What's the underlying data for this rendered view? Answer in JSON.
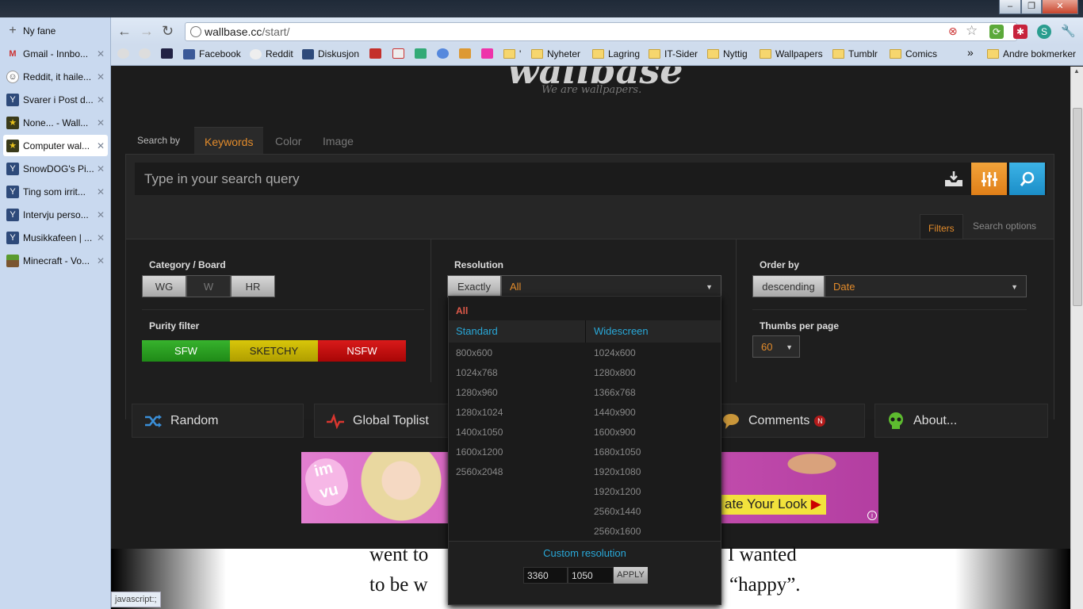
{
  "browser": {
    "window_controls": [
      "–",
      "❐",
      "✕"
    ],
    "url_host": "wallbase.cc",
    "url_path": "/start/",
    "status": "javascript:;"
  },
  "sidebar_tabs": [
    {
      "label": "Ny fane"
    },
    {
      "label": "Gmail - Innbo..."
    },
    {
      "label": "Reddit, it haile..."
    },
    {
      "label": "Svarer i Post d..."
    },
    {
      "label": "None... - Wall..."
    },
    {
      "label": "Computer wal...",
      "active": true
    },
    {
      "label": "SnowDOG's Pi..."
    },
    {
      "label": "Ting som irrit..."
    },
    {
      "label": "Intervju perso..."
    },
    {
      "label": "Musikkafeen | ..."
    },
    {
      "label": "Minecraft - Vo..."
    }
  ],
  "bookmarks": {
    "items": [
      "Facebook",
      "Reddit",
      "Diskusjon"
    ],
    "folders": [
      "Nyheter",
      "Lagring",
      "IT-Sider",
      "Nyttig",
      "Wallpapers",
      "Tumblr",
      "Comics"
    ],
    "more": "»",
    "other": "Andre bokmerker"
  },
  "site": {
    "logo": "wallbase",
    "tagline": "We are wallpapers."
  },
  "search": {
    "by_label": "Search by",
    "tabs": [
      "Keywords",
      "Color",
      "Image"
    ],
    "placeholder": "Type in your search query",
    "filter_tabs": [
      "Filters",
      "Search options"
    ]
  },
  "filters": {
    "category_label": "Category / Board",
    "category_buttons": [
      "WG",
      "W",
      "HR"
    ],
    "purity_label": "Purity filter",
    "purity": [
      "SFW",
      "SKETCHY",
      "NSFW"
    ],
    "resolution_label": "Resolution",
    "resolution_mode": "Exactly",
    "resolution_value": "All",
    "order_label": "Order by",
    "order_direction": "descending",
    "order_field": "Date",
    "thumbs_label": "Thumbs per page",
    "thumbs_value": "60"
  },
  "nav": {
    "random": "Random",
    "toplist": "Global Toplist",
    "comments": "Comments",
    "comments_badge": "N",
    "about": "About..."
  },
  "dropdown": {
    "all": "All",
    "standard_label": "Standard",
    "widescreen_label": "Widescreen",
    "standard": [
      "800x600",
      "1024x768",
      "1280x960",
      "1280x1024",
      "1400x1050",
      "1600x1200",
      "2560x2048"
    ],
    "widescreen": [
      "1024x600",
      "1280x800",
      "1366x768",
      "1440x900",
      "1600x900",
      "1680x1050",
      "1920x1080",
      "1920x1200",
      "2560x1440",
      "2560x1600"
    ],
    "custom_label": "Custom resolution",
    "custom_width": "3360",
    "custom_height": "1050",
    "apply": "APPLY"
  },
  "ad": {
    "brand": "im vu",
    "cta": "ate Your Look",
    "info": "i"
  },
  "bottom_text": {
    "l1a": "went to",
    "l1b": "I wanted",
    "l2a": "to be w",
    "l2b": "“happy”."
  },
  "colors": {
    "accent": "#e28b2b",
    "link": "#29a8d8",
    "sfw": "#2a9d23",
    "sketchy": "#c9b600",
    "nsfw": "#c00d0d"
  }
}
